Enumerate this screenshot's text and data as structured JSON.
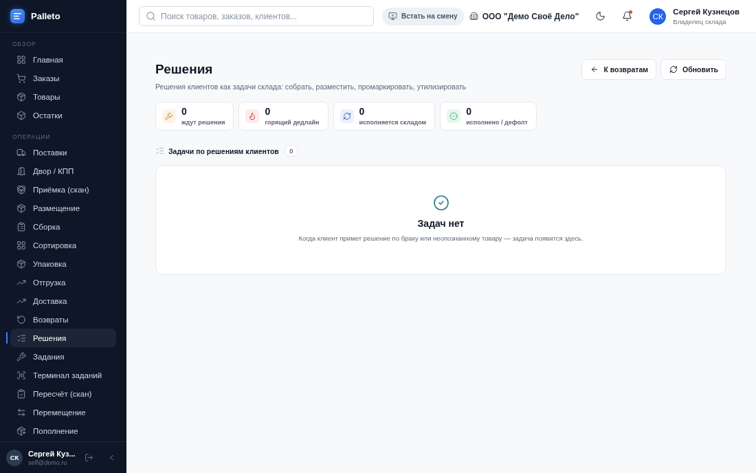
{
  "sidebar": {
    "brand": "Palleto",
    "sections": [
      {
        "title": "ОБЗОР",
        "items": [
          {
            "label": "Главная",
            "selected": false
          },
          {
            "label": "Заказы",
            "selected": false
          },
          {
            "label": "Товары",
            "selected": false
          },
          {
            "label": "Остатки",
            "selected": false
          }
        ]
      },
      {
        "title": "ОПЕРАЦИИ",
        "items": [
          {
            "label": "Поставки",
            "selected": false
          },
          {
            "label": "Двор / КПП",
            "selected": false
          },
          {
            "label": "Приёмка (скан)",
            "selected": false
          },
          {
            "label": "Размещение",
            "selected": false
          },
          {
            "label": "Сборка",
            "selected": false
          },
          {
            "label": "Сортировка",
            "selected": false
          },
          {
            "label": "Упаковка",
            "selected": false
          },
          {
            "label": "Отгрузка",
            "selected": false
          },
          {
            "label": "Доставка",
            "selected": false
          },
          {
            "label": "Возвраты",
            "selected": false
          },
          {
            "label": "Решения",
            "selected": true
          },
          {
            "label": "Задания",
            "selected": false
          },
          {
            "label": "Терминал заданий",
            "selected": false
          },
          {
            "label": "Пересчёт (скан)",
            "selected": false
          },
          {
            "label": "Перемещение",
            "selected": false
          },
          {
            "label": "Пополнение",
            "selected": false
          }
        ]
      }
    ],
    "user": {
      "initials": "СК",
      "name": "Сергей Куз...",
      "email": "self@demo.ru"
    }
  },
  "header": {
    "search": {
      "placeholder": "Поиск товаров, заказов, клиентов..."
    },
    "shift_button": "Встать на смену",
    "organization": "ООО \"Демо Своё Дело\"",
    "notifications": {
      "unread": true
    },
    "user": {
      "initials": "СК",
      "name": "Сергей Кузнецов",
      "role": "Владелец склада"
    }
  },
  "page": {
    "title": "Решения",
    "subtitle": "Решения клиентов как задачи склада: собрать, разместить, промаркировать, утилизировать",
    "actions": [
      {
        "label": "К возвратам",
        "kind": "back"
      },
      {
        "label": "Обновить",
        "kind": "refresh"
      }
    ],
    "stats": [
      {
        "value": "0",
        "label": "ждут решения",
        "color": "#fcf3e6"
      },
      {
        "value": "0",
        "label": "горящий дедлайн",
        "color": "#fdeceb"
      },
      {
        "value": "0",
        "label": "исполняется складом",
        "color": "#ebf0fc"
      },
      {
        "value": "0",
        "label": "исполнено / дефолт",
        "color": "#e8f6ef"
      }
    ],
    "tasks": {
      "title": "Задачи по решениям клиентов",
      "count": "0",
      "empty": {
        "title": "Задач нет",
        "text": "Когда клиент примет решение по браку или неопознанному товару — задача появится здесь."
      }
    }
  }
}
